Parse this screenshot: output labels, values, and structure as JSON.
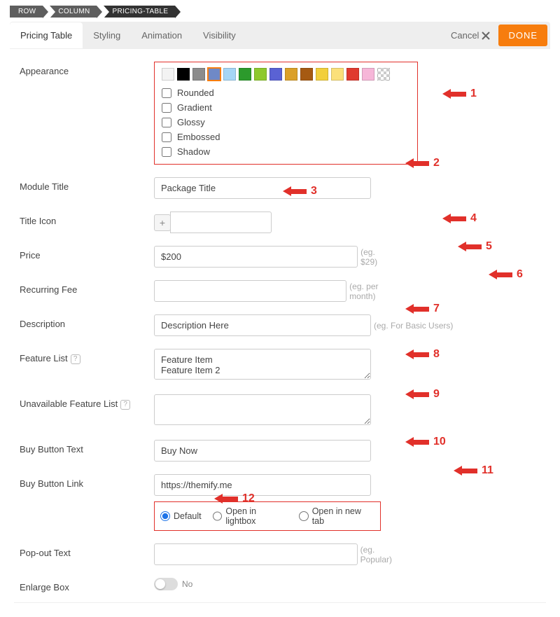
{
  "breadcrumb": [
    "ROW",
    "COLUMN",
    "PRICING-TABLE"
  ],
  "tabs": {
    "t0": "Pricing Table",
    "t1": "Styling",
    "t2": "Animation",
    "t3": "Visibility"
  },
  "header": {
    "cancel": "Cancel",
    "done": "DONE"
  },
  "labels": {
    "appearance": "Appearance",
    "module_title": "Module Title",
    "title_icon": "Title Icon",
    "price": "Price",
    "recurring": "Recurring Fee",
    "description": "Description",
    "feature_list": "Feature List",
    "unavail_list": "Unavailable Feature List",
    "buy_text": "Buy Button Text",
    "buy_link": "Buy Button Link",
    "popout": "Pop-out Text",
    "enlarge": "Enlarge Box"
  },
  "appearance": {
    "colors": [
      "#f3f3f3",
      "#000000",
      "#8c8c8c",
      "#6f89c7",
      "#a6d6f6",
      "#2c9a2c",
      "#8ec92e",
      "#5a62d4",
      "#dba028",
      "#a65a12",
      "#f2cf3c",
      "#fbe07a",
      "#e03a2f",
      "#f6b6d8"
    ],
    "selected_index": 3,
    "checks": {
      "rounded": "Rounded",
      "gradient": "Gradient",
      "glossy": "Glossy",
      "embossed": "Embossed",
      "shadow": "Shadow"
    }
  },
  "values": {
    "module_title": "Package Title",
    "price": "$200",
    "recurring": "",
    "description": "Description Here",
    "feature_list": "Feature Item\nFeature Item 2",
    "unavail_list": "",
    "buy_text": "Buy Now",
    "buy_link": "https://themify.me",
    "popout": "",
    "enlarge": "No"
  },
  "hints": {
    "price": "(eg. $29)",
    "recurring": "(eg. per month)",
    "description": "(eg. For Basic Users)",
    "popout": "(eg. Popular)"
  },
  "link_radios": {
    "r0": "Default",
    "r1": "Open in lightbox",
    "r2": "Open in new tab"
  },
  "annotations": {
    "a1": "1",
    "a2": "2",
    "a3": "3",
    "a4": "4",
    "a5": "5",
    "a6": "6",
    "a7": "7",
    "a8": "8",
    "a9": "9",
    "a10": "10",
    "a11": "11",
    "a12": "12"
  }
}
